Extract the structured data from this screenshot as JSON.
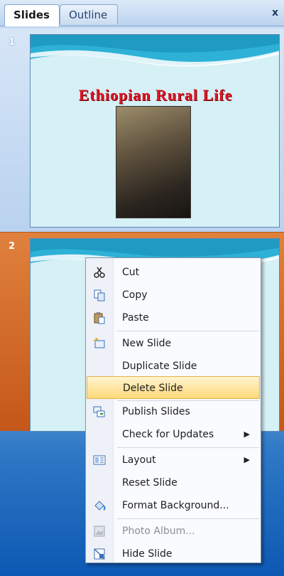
{
  "tabs": [
    {
      "label": "Slides"
    },
    {
      "label": "Outline"
    }
  ],
  "close_label": "x",
  "slides": [
    {
      "number": "1",
      "title": "Ethiopian Rural Life"
    },
    {
      "number": "2"
    }
  ],
  "context_menu": {
    "items": [
      {
        "label": "Cut",
        "icon": "scissors-icon"
      },
      {
        "label": "Copy",
        "icon": "copy-icon"
      },
      {
        "label": "Paste",
        "icon": "paste-icon"
      },
      {
        "label": "New Slide",
        "icon": "new-slide-icon"
      },
      {
        "label": "Duplicate Slide"
      },
      {
        "label": "Delete Slide",
        "highlighted": true
      },
      {
        "label": "Publish Slides",
        "icon": "publish-icon"
      },
      {
        "label": "Check for Updates",
        "submenu": true
      },
      {
        "label": "Layout",
        "icon": "layout-icon",
        "submenu": true
      },
      {
        "label": "Reset Slide"
      },
      {
        "label": "Format Background...",
        "icon": "paint-bucket-icon"
      },
      {
        "label": "Photo Album...",
        "icon": "photo-album-icon",
        "disabled": true
      },
      {
        "label": "Hide Slide",
        "icon": "hide-slide-icon"
      }
    ]
  },
  "colors": {
    "selected_row": "#c4571a",
    "menu_highlight": "#ffd97a",
    "title_red": "#e01525"
  }
}
